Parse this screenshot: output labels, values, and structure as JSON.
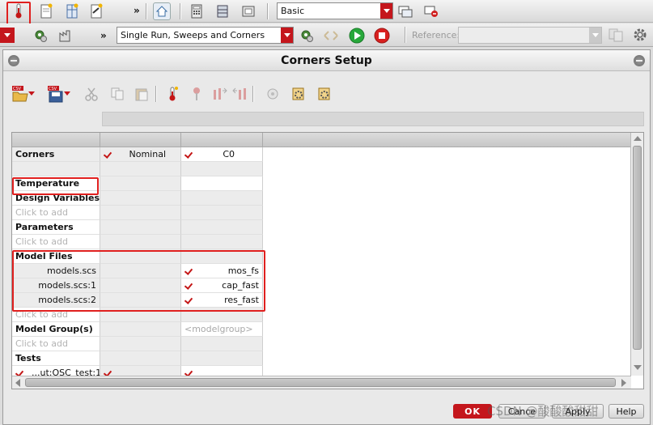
{
  "toolbar1": {
    "more_label": "»",
    "more_label2": "»",
    "config_combo_value": "Basic"
  },
  "toolbar2": {
    "more_label": "»",
    "run_mode_value": "Single Run, Sweeps and Corners",
    "reference_label": "Reference:",
    "reference_value": ""
  },
  "dialog": {
    "title": "Corners Setup",
    "colors": {
      "accent": "#c4161c",
      "highlight_box": "#e0201f"
    }
  },
  "grid": {
    "header_row": {
      "label": "Corners",
      "corners": [
        {
          "name": "Nominal",
          "checked": true
        },
        {
          "name": "C0",
          "checked": true
        }
      ]
    },
    "rows": [
      {
        "label": "Temperature",
        "bold": true,
        "c1": "",
        "c2": ""
      },
      {
        "label": "Design Variables",
        "bold": true,
        "c1": "",
        "c2": ""
      },
      {
        "label": "Click to add",
        "hint": true,
        "c1": "",
        "c2": ""
      },
      {
        "label": "Parameters",
        "bold": true,
        "c1": "",
        "c2": ""
      },
      {
        "label": "Click to add",
        "hint": true,
        "c1": "",
        "c2": ""
      },
      {
        "label": "Model Files",
        "bold": true,
        "c1": "",
        "c2": ""
      },
      {
        "label": "models.scs",
        "c1": "",
        "c2": "mos_fs"
      },
      {
        "label": "models.scs:1",
        "c1": "",
        "c2": "cap_fast"
      },
      {
        "label": "models.scs:2",
        "c1": "",
        "c2": "res_fast"
      },
      {
        "label": "Click to add",
        "hint": true,
        "c1": "",
        "c2": ""
      },
      {
        "label": "Model Group(s)",
        "bold": true,
        "c1": "",
        "c2": "<modelgroup>"
      },
      {
        "label": "Click to add",
        "hint": true,
        "c1": "",
        "c2": ""
      },
      {
        "label": "Tests",
        "bold": true,
        "c1": "",
        "c2": ""
      },
      {
        "label": "...ut:OSC_test:1",
        "c1": "",
        "c2": ""
      }
    ]
  },
  "buttons": {
    "ok": "OK",
    "cancel": "Cance",
    "apply": "Apply",
    "help": "Help"
  },
  "watermark": "CSDN @酸酸酸甜甜"
}
